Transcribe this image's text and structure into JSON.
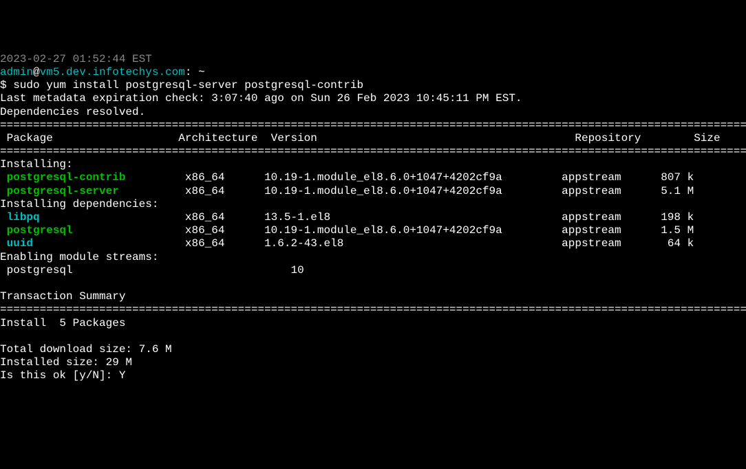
{
  "timestamp": "2023-02-27 01:52:44 EST",
  "prompt": {
    "user": "admin",
    "at": "@",
    "host": "vm5.dev.infotechys.com",
    "suffix": ": ~"
  },
  "command": "$ sudo yum install postgresql-server postgresql-contrib",
  "metadata_line": "Last metadata expiration check: 3:07:40 ago on Sun 26 Feb 2023 10:45:11 PM EST.",
  "deps_resolved": "Dependencies resolved.",
  "hr": "=================================================================================================================",
  "headers": {
    "package": " Package",
    "arch": "Architecture",
    "version": "Version",
    "repo": "Repository",
    "size": "Size"
  },
  "section_installing": "Installing:",
  "section_deps": "Installing dependencies:",
  "section_streams": "Enabling module streams:",
  "packages": {
    "contrib": {
      "name": "postgresql-contrib",
      "arch": "x86_64",
      "version": "10.19-1.module_el8.6.0+1047+4202cf9a",
      "repo": "appstream",
      "size": "807 k"
    },
    "server": {
      "name": "postgresql-server",
      "arch": "x86_64",
      "version": "10.19-1.module_el8.6.0+1047+4202cf9a",
      "repo": "appstream",
      "size": "5.1 M"
    },
    "libpq": {
      "name": "libpq",
      "arch": "x86_64",
      "version": "13.5-1.el8",
      "repo": "appstream",
      "size": "198 k"
    },
    "pg": {
      "name": "postgresql",
      "arch": "x86_64",
      "version": "10.19-1.module_el8.6.0+1047+4202cf9a",
      "repo": "appstream",
      "size": "1.5 M"
    },
    "uuid": {
      "name": "uuid",
      "arch": "x86_64",
      "version": "1.6.2-43.el8",
      "repo": "appstream",
      "size": " 64 k"
    }
  },
  "stream": {
    "name": " postgresql",
    "version": "10"
  },
  "txn_summary": "Transaction Summary",
  "install_count": "Install  5 Packages",
  "download_size": "Total download size: 7.6 M",
  "installed_size": "Installed size: 29 M",
  "confirm_prompt": "Is this ok [y/N]: ",
  "confirm_answer": "Y"
}
